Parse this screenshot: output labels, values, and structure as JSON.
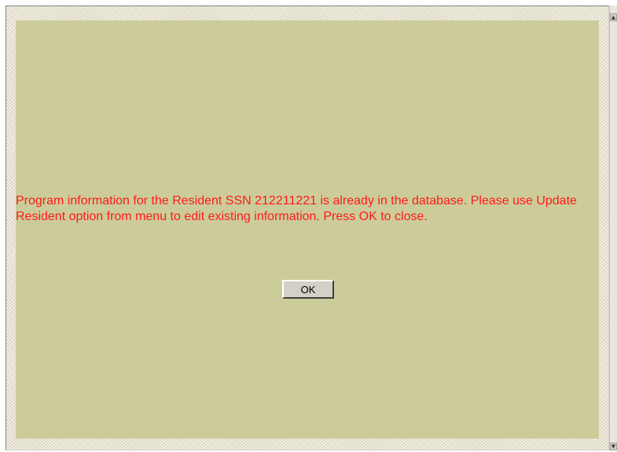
{
  "dialog": {
    "message": "Program information for the Resident SSN 212211221 is already in the database. Please use Update Resident option from menu to edit existing information. Press OK to close.",
    "ok_label": "OK"
  },
  "colors": {
    "panel_background": "#cccc9a",
    "message_text": "#ff1a1a",
    "button_face": "#d4d0c8"
  },
  "icons": {
    "scroll_up": "triangle-up-icon",
    "scroll_down": "triangle-down-icon"
  }
}
